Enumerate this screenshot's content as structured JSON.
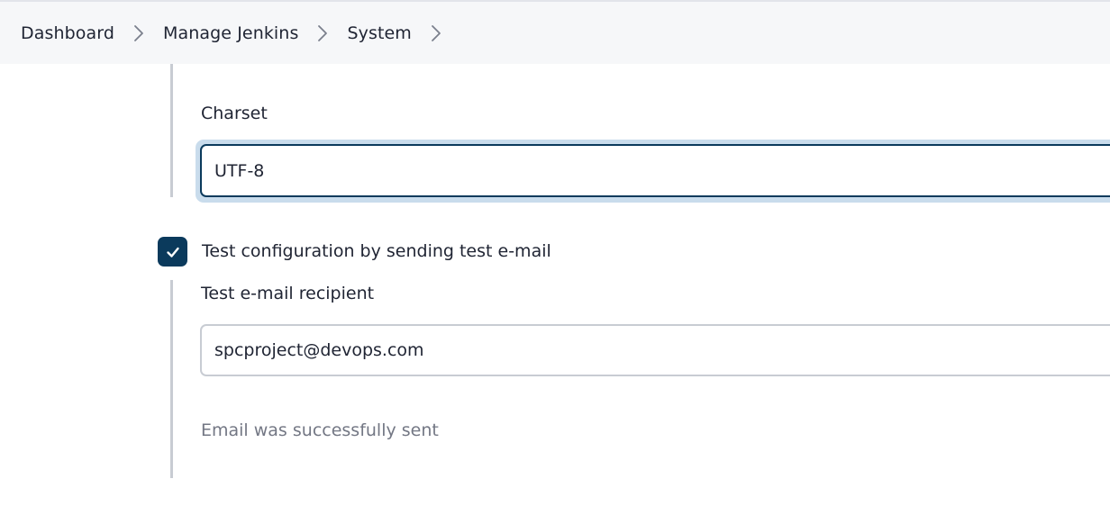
{
  "breadcrumb": {
    "items": [
      {
        "label": "Dashboard"
      },
      {
        "label": "Manage Jenkins"
      },
      {
        "label": "System"
      }
    ],
    "separator_icon": "chevron-right-icon"
  },
  "form": {
    "charset": {
      "label": "Charset",
      "value": "UTF-8"
    },
    "test_config": {
      "label": "Test configuration by sending test e-mail",
      "checked": true
    },
    "test_recipient": {
      "label": "Test e-mail recipient",
      "value": "spcproject@devops.com"
    },
    "status_message": "Email was successfully sent"
  },
  "colors": {
    "accent": "#0b3a5c",
    "focus_ring": "#c9dcec",
    "muted_text": "#737784",
    "breadcrumb_bg": "#f6f7f9"
  }
}
